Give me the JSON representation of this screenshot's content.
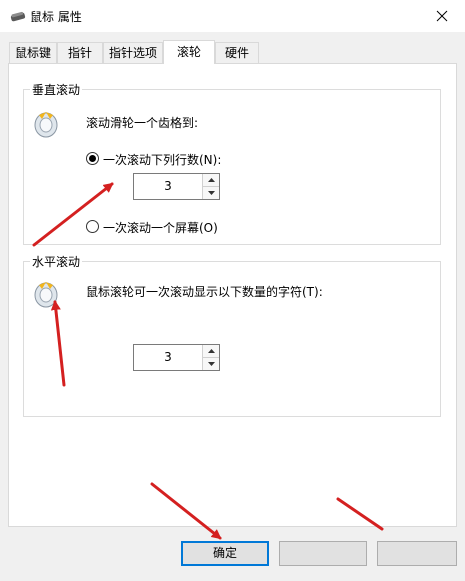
{
  "window": {
    "title": "鼠标 属性",
    "icon": "mouse-icon"
  },
  "tabs": [
    {
      "label": "鼠标键",
      "active": false
    },
    {
      "label": "指针",
      "active": false
    },
    {
      "label": "指针选项",
      "active": false
    },
    {
      "label": "滚轮",
      "active": true
    },
    {
      "label": "硬件",
      "active": false
    }
  ],
  "vertical": {
    "group_label": "垂直滚动",
    "description": "滚动滑轮一个齿格到:",
    "radio_lines_label": "一次滚动下列行数(N):",
    "radio_lines_selected": true,
    "lines_value": "3",
    "radio_screen_label": "一次滚动一个屏幕(O)",
    "radio_screen_selected": false
  },
  "horizontal": {
    "group_label": "水平滚动",
    "description": "鼠标滚轮可一次滚动显示以下数量的字符(T):",
    "chars_value": "3"
  },
  "buttons": {
    "ok_label": "确定",
    "cancel_label": "",
    "apply_label": ""
  },
  "colors": {
    "annotation_arrow": "#d42020",
    "accent": "#0078d7"
  }
}
